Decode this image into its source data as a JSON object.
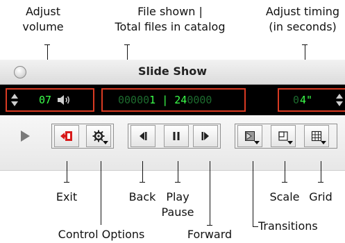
{
  "callouts": {
    "adjust_volume": [
      "Adjust",
      "volume"
    ],
    "file_shown": [
      "File shown |",
      "Total files in catalog"
    ],
    "adjust_timing": [
      "Adjust timing",
      "(in seconds)"
    ],
    "exit": "Exit",
    "back": "Back",
    "play_pause": [
      "Play",
      "Pause"
    ],
    "scale": "Scale",
    "grid": "Grid",
    "transitions": "Transitions",
    "control_options": "Control Options",
    "forward": "Forward"
  },
  "window": {
    "title": "Slide Show"
  },
  "display": {
    "volume": {
      "value": "07"
    },
    "file": {
      "current_prefix": "00000",
      "current": "1",
      "separator": "|",
      "total": "24",
      "total_suffix": "0000"
    },
    "timing": {
      "prefix": "0",
      "value": "4\""
    }
  },
  "icons": {
    "play": "play-triangle",
    "exit": "exit-icon",
    "control_options": "gear-icon",
    "back": "back-icon",
    "pause": "pause-icon",
    "forward": "forward-icon",
    "transitions": "transitions-icon",
    "scale": "scale-icon",
    "grid": "grid-icon"
  },
  "colors": {
    "lcd_bright": "#3bff4a",
    "lcd_dim": "#1d6b2e",
    "highlight_border": "#d93a22",
    "exit_icon": "#d81b1b"
  }
}
